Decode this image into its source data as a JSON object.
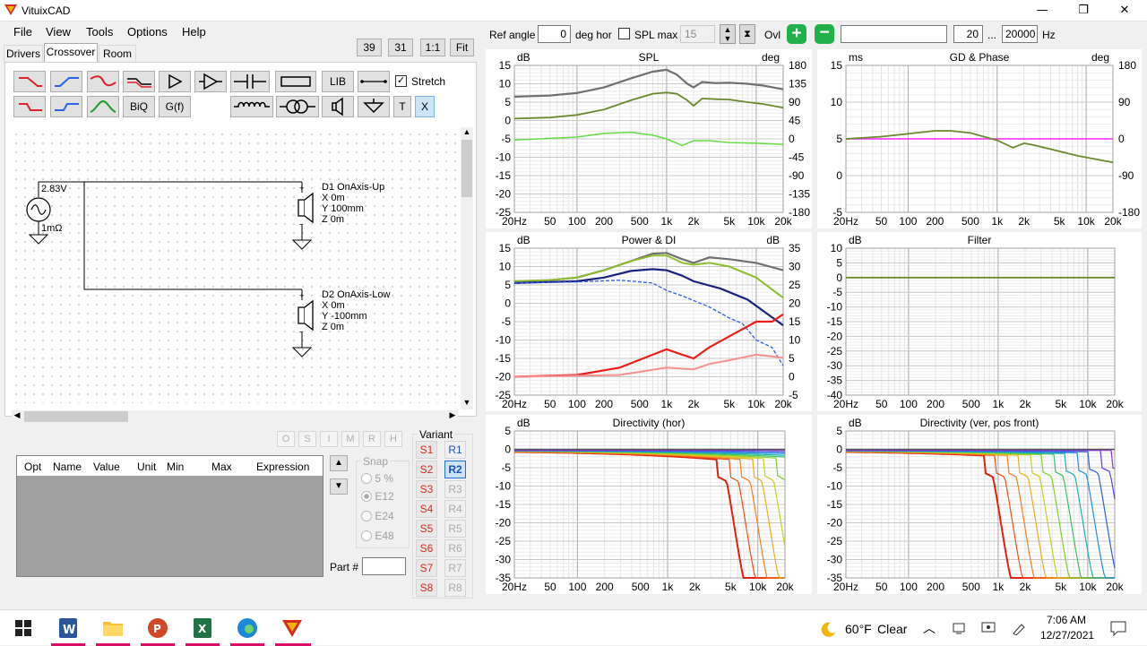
{
  "window": {
    "title": "VituixCAD",
    "minimize": "—",
    "restore": "❐",
    "close": "✕"
  },
  "menu": [
    "File",
    "View",
    "Tools",
    "Options",
    "Help"
  ],
  "top_buttons": [
    "39",
    "31",
    "1:1",
    "Fit"
  ],
  "tabs": [
    "Drivers",
    "Crossover",
    "Room"
  ],
  "crossover_toolbar": {
    "lib": "LIB",
    "biq": "BiQ",
    "gf": "G(f)",
    "t": "T",
    "x": "X",
    "stretch_label": "Stretch",
    "stretch_checked": true
  },
  "schematic": {
    "source_voltage": "2.83V",
    "source_impedance": "1mΩ",
    "driver1": {
      "name": "D1 OnAxis-Up",
      "x": "X 0m",
      "y": "Y 100mm",
      "z": "Z 0m"
    },
    "driver2": {
      "name": "D2 OnAxis-Low",
      "x": "X 0m",
      "y": "Y -100mm",
      "z": "Z 0m"
    }
  },
  "state_buttons": [
    "O",
    "S",
    "I",
    "M",
    "R",
    "H"
  ],
  "param_table": {
    "columns": [
      "Opt",
      "Name",
      "Value",
      "Unit",
      "Min",
      "Max",
      "Expression"
    ]
  },
  "snap": {
    "label": "Snap",
    "options": [
      "5 %",
      "E12",
      "E24",
      "E48"
    ],
    "selected": "E12"
  },
  "part_label": "Part #",
  "variant": {
    "label": "Variant",
    "s": [
      "S1",
      "S2",
      "S3",
      "S4",
      "S5",
      "S6",
      "S7",
      "S8"
    ],
    "r": [
      "R1",
      "R2",
      "R3",
      "R4",
      "R5",
      "R6",
      "R7",
      "R8"
    ],
    "active_r": "R2"
  },
  "charts_toolbar": {
    "ref_angle_label": "Ref angle",
    "ref_angle": "0",
    "deg_hor": "deg hor",
    "spl_max_label": "SPL max",
    "spl_max": "15",
    "ovl": "Ovl",
    "freq_min": "20",
    "dots": "...",
    "freq_max": "20000",
    "hz": "Hz"
  },
  "charts": {
    "spl": {
      "title": "SPL",
      "left_unit": "dB",
      "right_unit": "deg",
      "left_ticks": [
        "15",
        "10",
        "5",
        "0",
        "-5",
        "-10",
        "-15",
        "-20",
        "-25"
      ],
      "right_ticks": [
        "180",
        "135",
        "90",
        "45",
        "0",
        "-45",
        "-90",
        "-135",
        "-180"
      ]
    },
    "gd": {
      "title": "GD & Phase",
      "left_unit": "ms",
      "right_unit": "deg",
      "left_ticks": [
        "15",
        "10",
        "5",
        "0",
        "-5"
      ],
      "right_ticks": [
        "180",
        "90",
        "0",
        "-90",
        "-180"
      ]
    },
    "power": {
      "title": "Power & DI",
      "left_unit": "dB",
      "right_unit": "dB",
      "left_ticks": [
        "15",
        "10",
        "5",
        "0",
        "-5",
        "-10",
        "-15",
        "-20",
        "-25"
      ],
      "right_ticks": [
        "35",
        "30",
        "25",
        "20",
        "15",
        "10",
        "5",
        "0",
        "-5"
      ]
    },
    "filter": {
      "title": "Filter",
      "left_unit": "dB",
      "left_ticks": [
        "10",
        "5",
        "0",
        "-5",
        "-10",
        "-15",
        "-20",
        "-25",
        "-30",
        "-35",
        "-40"
      ]
    },
    "dirh": {
      "title": "Directivity (hor)",
      "left_unit": "dB",
      "left_ticks": [
        "5",
        "0",
        "-5",
        "-10",
        "-15",
        "-20",
        "-25",
        "-30",
        "-35"
      ]
    },
    "dirv": {
      "title": "Directivity (ver, pos front)",
      "left_unit": "dB",
      "left_ticks": [
        "5",
        "0",
        "-5",
        "-10",
        "-15",
        "-20",
        "-25",
        "-30",
        "-35"
      ]
    },
    "x_ticks": [
      "20Hz",
      "50",
      "100",
      "200",
      "500",
      "1k",
      "2k",
      "5k",
      "10k",
      "20k"
    ]
  },
  "taskbar": {
    "weather_temp": "60°F",
    "weather_cond": "Clear",
    "time": "7:06 AM",
    "date": "12/27/2021"
  }
}
